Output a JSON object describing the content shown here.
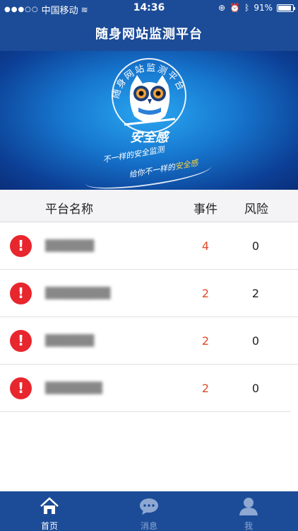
{
  "status_bar": {
    "signal": "●●●○○",
    "carrier": "中国移动",
    "wifi": "≋",
    "time": "14:36",
    "battery": "91%",
    "battery_level": 0.91
  },
  "nav": {
    "title": "随身网站监测平台"
  },
  "banner": {
    "arc_text": "随身网站监测平台",
    "brand": "安全感",
    "slogan_line1": "不一样的安全监测",
    "slogan_line2_prefix": "给你不一样的",
    "slogan_line2_highlight": "安全感"
  },
  "table": {
    "headers": {
      "name": "平台名称",
      "events": "事件",
      "risk": "风险"
    },
    "rows": [
      {
        "name": "██████",
        "events": "4",
        "risk": "0"
      },
      {
        "name": "████████",
        "events": "2",
        "risk": "2"
      },
      {
        "name": "██████",
        "events": "2",
        "risk": "0"
      },
      {
        "name": "███████",
        "events": "2",
        "risk": "0"
      }
    ]
  },
  "tabs": [
    {
      "label": "首页",
      "icon": "home-icon",
      "active": true
    },
    {
      "label": "消息",
      "icon": "chat-icon",
      "active": false
    },
    {
      "label": "我",
      "icon": "user-icon",
      "active": false
    }
  ],
  "colors": {
    "primary": "#1c4c98",
    "alert": "#e8262d",
    "event_count": "#e34a2a",
    "tab_inactive": "#8ea8d2"
  }
}
